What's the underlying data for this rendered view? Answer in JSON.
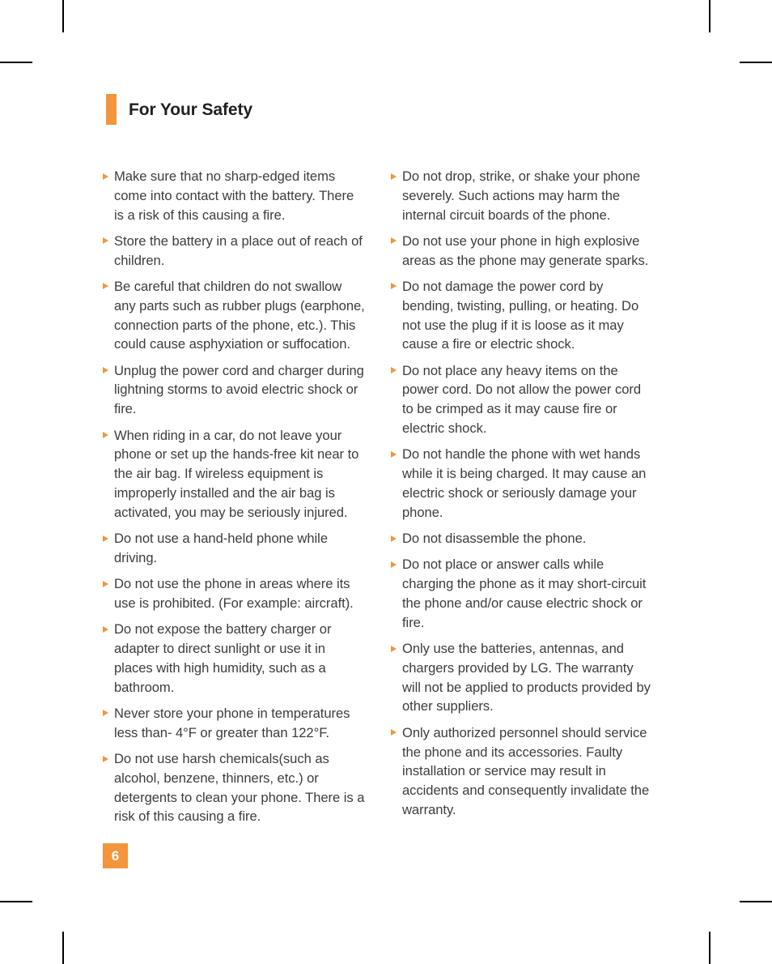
{
  "document": {
    "heading": "For Your Safety",
    "page_number": "6",
    "accent_color": "#F2953D",
    "text_color": "#3d3d3d",
    "heading_color": "#231f20",
    "bullet_icon": "orange-triangle-bullet"
  },
  "columns": [
    {
      "id": "left-column",
      "items": [
        "Make sure that no sharp-edged items come into contact with the battery. There is a risk of this causing a fire.",
        "Store the battery in a place out of reach of children.",
        "Be careful that children do not swallow any parts such as rubber plugs (earphone, connection parts of the phone, etc.). This could cause asphyxiation or suffocation.",
        "Unplug the power cord and charger during lightning storms to avoid electric shock or fire.",
        "When riding in a car, do not leave your phone or set up the hands-free kit near to the air bag. If wireless equipment is improperly installed and the air bag is activated, you may be seriously injured.",
        "Do not use a hand-held phone while driving.",
        "Do not use the phone in areas where its use is prohibited. (For example: aircraft).",
        "Do not expose the battery charger or adapter to direct sunlight or use it in places with high humidity, such as a bathroom.",
        "Never store your phone in temperatures less than- 4°F or greater than 122°F.",
        "Do not use harsh chemicals(such as alcohol, benzene, thinners, etc.) or detergents to clean your phone. There is a risk of this causing a fire."
      ]
    },
    {
      "id": "right-column",
      "items": [
        "Do not drop, strike, or shake your phone severely. Such actions may harm the internal circuit boards of the phone.",
        "Do not use your phone in high explosive areas as the phone may generate sparks.",
        "Do not damage the power cord by bending, twisting, pulling, or heating. Do not use the plug if it is loose as it may cause a fire or electric shock.",
        "Do not place any heavy items on the power cord. Do not allow the power cord to be crimped as it may cause fire or electric shock.",
        "Do not handle the phone with wet hands while it is being charged. It may cause an electric shock or seriously damage your phone.",
        "Do not disassemble the phone.",
        "Do not place or answer calls while charging the phone as it may short-circuit the phone and/or cause electric shock or fire.",
        "Only use the batteries, antennas, and chargers provided by LG. The warranty will not be applied to products provided by other suppliers.",
        "Only authorized personnel should service the phone and its accessories. Faulty installation or service may result in accidents and consequently invalidate the warranty."
      ]
    }
  ]
}
